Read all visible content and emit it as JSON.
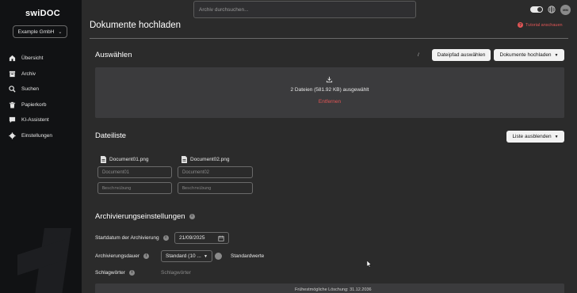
{
  "app": {
    "logo": "swiDOC",
    "company": "Example GmbH"
  },
  "sidebar": {
    "items": [
      {
        "label": "Übersicht",
        "icon": "home-icon"
      },
      {
        "label": "Archiv",
        "icon": "archive-icon"
      },
      {
        "label": "Suchen",
        "icon": "search-icon"
      },
      {
        "label": "Papierkorb",
        "icon": "trash-icon"
      },
      {
        "label": "KI-Assistent",
        "icon": "chat-icon"
      },
      {
        "label": "Einstellungen",
        "icon": "gear-icon"
      }
    ]
  },
  "header": {
    "search_placeholder": "Archiv durchsuchen...",
    "avatar_initials": "MM",
    "theme_toggle_on": true
  },
  "page": {
    "title": "Dokumente hochladen",
    "tutorial": "Tutorial anschauen"
  },
  "select_section": {
    "title": "Auswählen",
    "path": "/",
    "filepath_button": "Dateipfad auswählen",
    "upload_button": "Dokumente hochladen",
    "selected_text": "2 Dateien (581.92 KB) ausgewählt",
    "remove_link": "Entfernen"
  },
  "file_list": {
    "title": "Dateiliste",
    "hide_button": "Liste ausblenden",
    "files": [
      {
        "name": "Document01.png",
        "title_placeholder": "Document01",
        "desc_placeholder": "Beschreibung"
      },
      {
        "name": "Document02.png",
        "title_placeholder": "Document02",
        "desc_placeholder": "Beschreibung"
      }
    ]
  },
  "archive_settings": {
    "title": "Archivierungseinstellungen",
    "start_label": "Startdatum der Archivierung",
    "start_value": "21/09/2025",
    "duration_label": "Archivierungsdauer",
    "duration_value": "Standard (10 ...",
    "defaults_label": "Standardwerte",
    "keywords_label": "Schlagwörter",
    "keywords_placeholder": "Schlagwörter",
    "earliest_deletion": "Frühestmögliche Löschung: 31.12.2036"
  },
  "colors": {
    "accent_red": "#e05555",
    "sidebar_bg": "#111214",
    "main_bg": "#2b2b2b",
    "panel_bg": "#3b3b3d"
  }
}
